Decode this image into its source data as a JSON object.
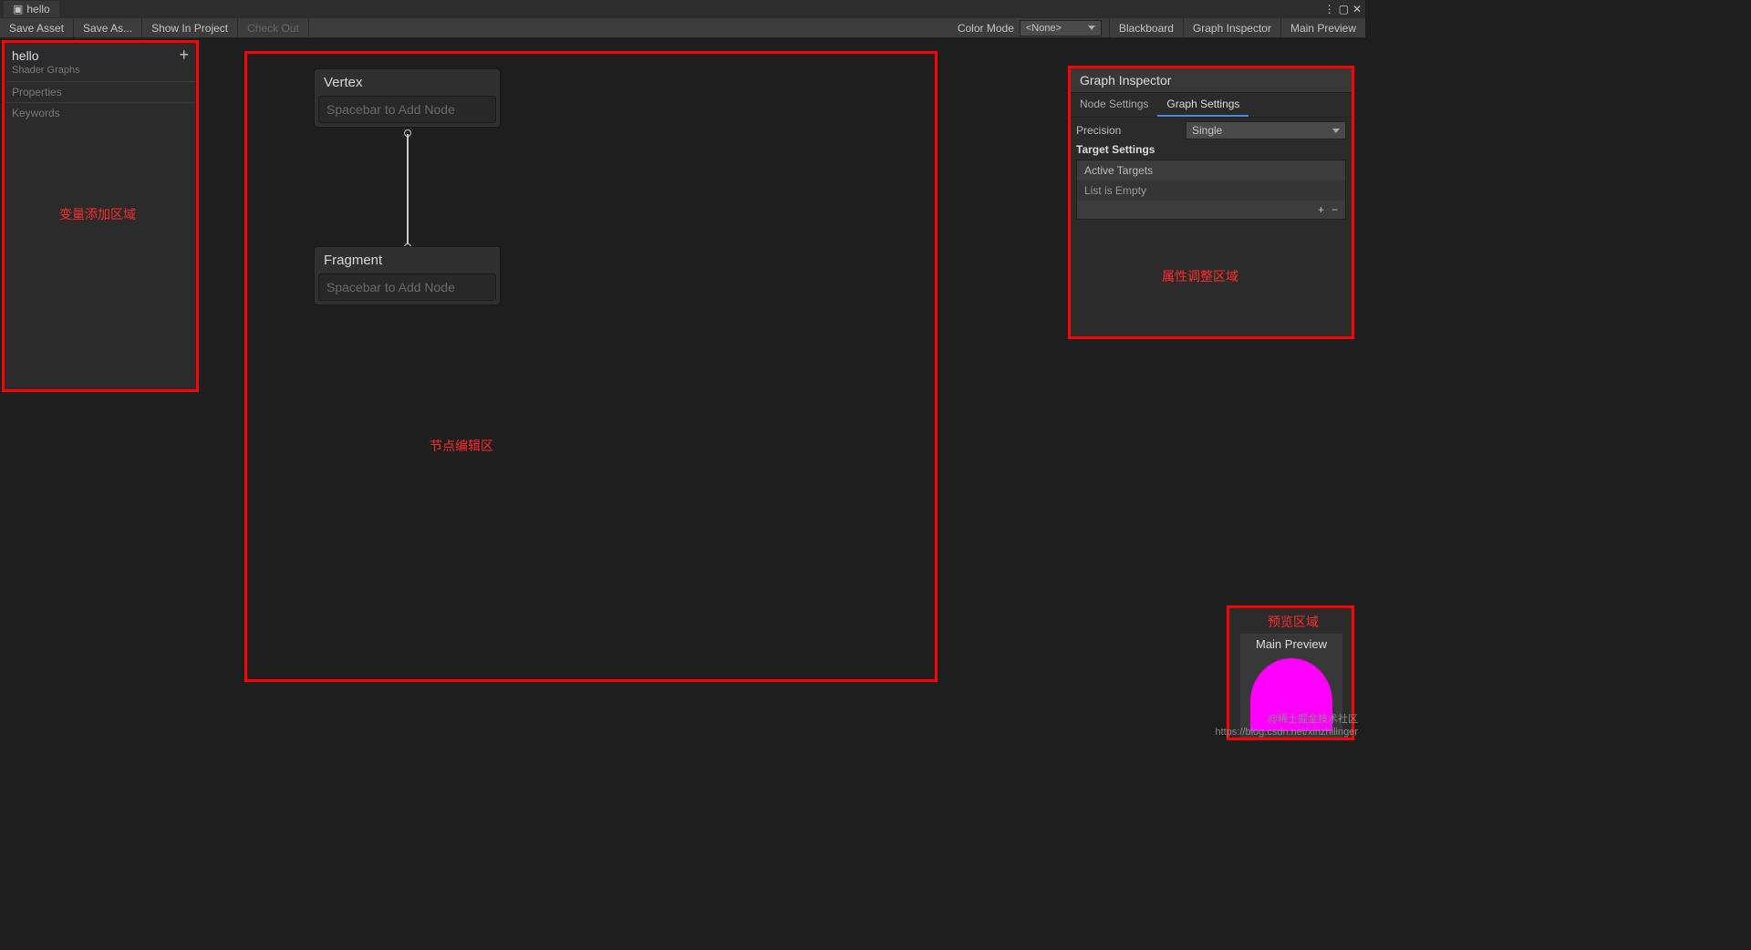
{
  "titleBar": {
    "tab": "hello"
  },
  "toolbar": {
    "saveAsset": "Save Asset",
    "saveAs": "Save As...",
    "showInProject": "Show In Project",
    "checkOut": "Check Out",
    "colorModeLabel": "Color Mode",
    "colorModeValue": "<None>",
    "blackboard": "Blackboard",
    "graphInspector": "Graph Inspector",
    "mainPreview": "Main Preview"
  },
  "blackboard": {
    "title": "hello",
    "subtitle": "Shader Graphs",
    "sections": [
      "Properties",
      "Keywords"
    ],
    "annotation": "变量添加区域"
  },
  "nodeZone": {
    "annotation": "节点编辑区",
    "nodes": {
      "vertex": {
        "title": "Vertex",
        "hint": "Spacebar to Add Node"
      },
      "fragment": {
        "title": "Fragment",
        "hint": "Spacebar to Add Node"
      }
    }
  },
  "inspector": {
    "title": "Graph Inspector",
    "tabs": {
      "nodeSettings": "Node Settings",
      "graphSettings": "Graph Settings"
    },
    "precisionLabel": "Precision",
    "precisionValue": "Single",
    "targetSettings": "Target Settings",
    "activeTargets": "Active Targets",
    "listEmpty": "List is Empty",
    "annotation": "属性调整区域"
  },
  "preview": {
    "annotation": "预览区域",
    "title": "Main Preview"
  },
  "watermark": {
    "line1": "@稀土掘金技术社区",
    "line2": "https://blog.csdn.net/xinzhilinger"
  }
}
